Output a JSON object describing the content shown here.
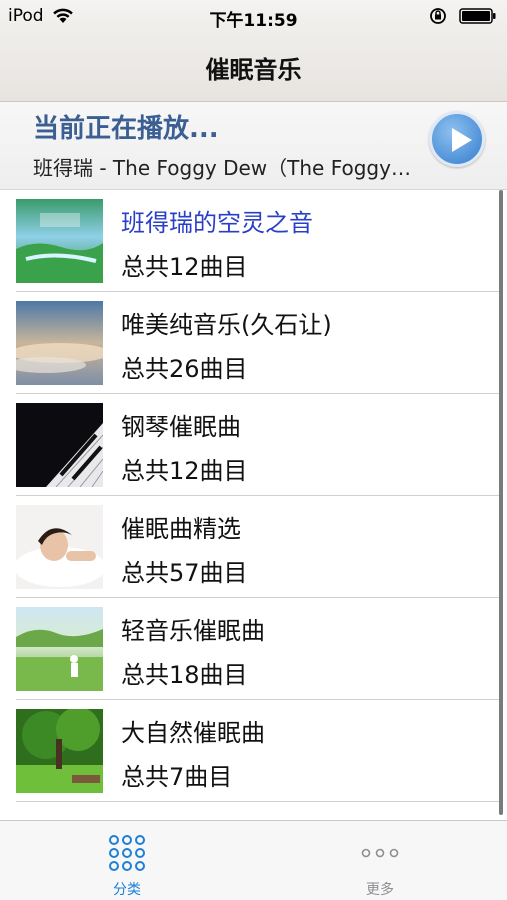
{
  "status_bar": {
    "carrier": "iPod",
    "time": "下午11:59"
  },
  "nav": {
    "title": "催眠音乐"
  },
  "now_playing": {
    "status": "当前正在播放...",
    "track": "班得瑞 - The Foggy Dew（The Foggy Dew）"
  },
  "playlists": [
    {
      "title": "班得瑞的空灵之音",
      "count": "总共12曲目",
      "active": true
    },
    {
      "title": "唯美纯音乐(久石让)",
      "count": "总共26曲目"
    },
    {
      "title": "钢琴催眠曲",
      "count": "总共12曲目"
    },
    {
      "title": "催眠曲精选",
      "count": "总共57曲目"
    },
    {
      "title": "轻音乐催眠曲",
      "count": "总共18曲目"
    },
    {
      "title": "大自然催眠曲",
      "count": "总共7曲目"
    }
  ],
  "tabs": {
    "category": "分类",
    "more": "更多"
  },
  "colors": {
    "tab_active": "#1e7fd6",
    "tab_inactive": "#8e8e93",
    "now_playing_status": "#3b5f93",
    "active_item": "#2a3fc7"
  },
  "icons": [
    "wifi-icon",
    "orientation-lock-icon",
    "battery-icon",
    "play-icon",
    "grid-icon",
    "more-dots-icon"
  ]
}
